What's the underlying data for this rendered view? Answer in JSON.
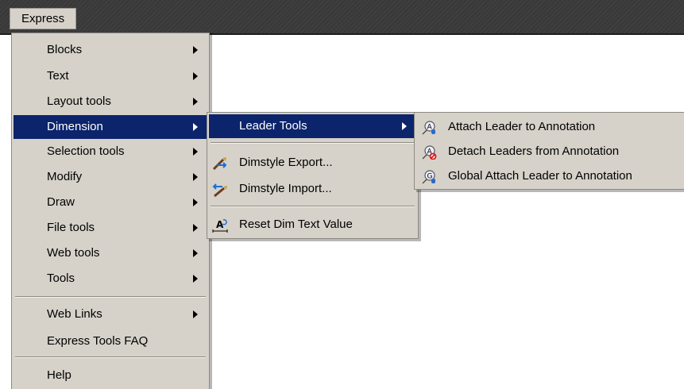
{
  "menubar": {
    "express": "Express"
  },
  "main_menu": {
    "blocks": "Blocks",
    "text": "Text",
    "layout_tools": "Layout tools",
    "dimension": "Dimension",
    "selection_tools": "Selection tools",
    "modify": "Modify",
    "draw": "Draw",
    "file_tools": "File tools",
    "web_tools": "Web tools",
    "tools": "Tools",
    "web_links": "Web Links",
    "faq": "Express Tools FAQ",
    "help": "Help"
  },
  "dimension_menu": {
    "leader_tools": "Leader Tools",
    "dimstyle_export": "Dimstyle Export...",
    "dimstyle_import": "Dimstyle Import...",
    "reset_dim_text": "Reset Dim Text Value"
  },
  "leader_menu": {
    "attach": "Attach Leader to Annotation",
    "detach": "Detach Leaders from Annotation",
    "global_attach": "Global Attach Leader to Annotation"
  },
  "colors": {
    "menu_bg": "#d6d2c9",
    "highlight": "#0b246b",
    "menubar": "#3c3c3c"
  }
}
